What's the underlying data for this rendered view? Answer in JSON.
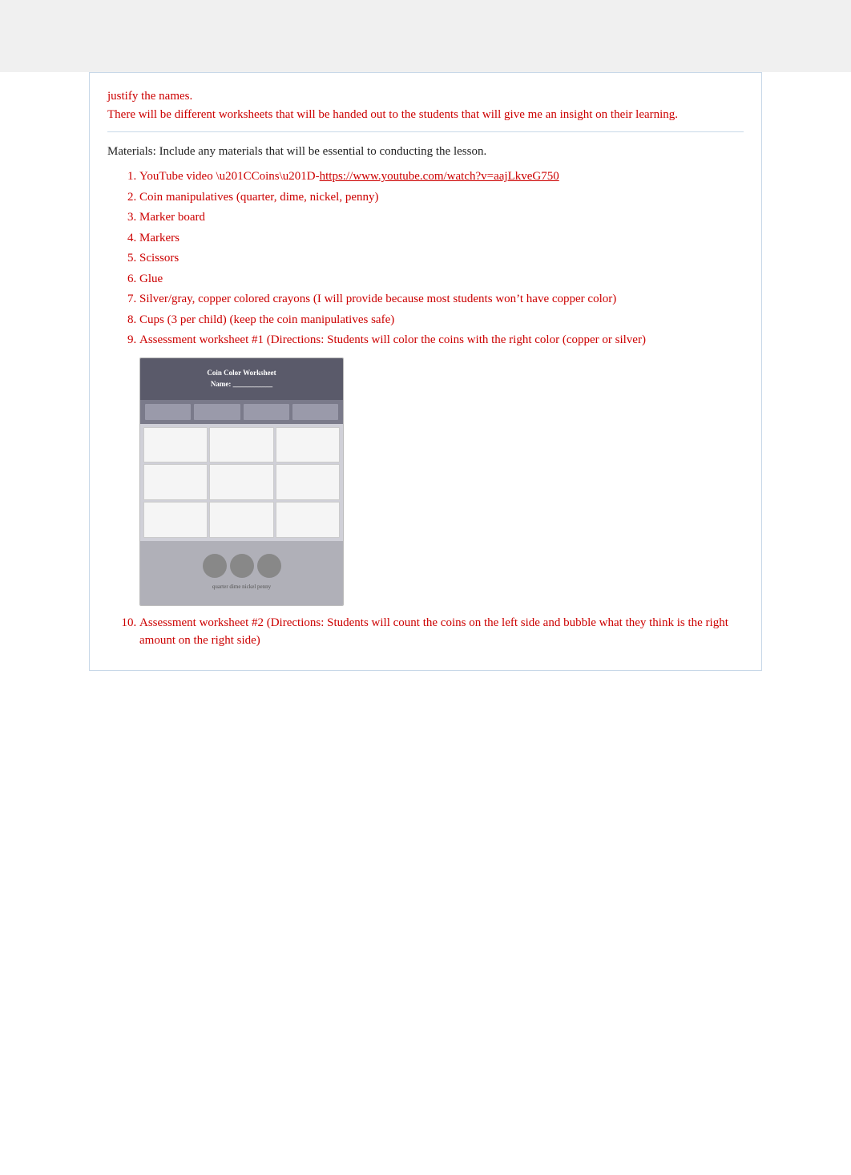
{
  "intro": {
    "line1": "justify the names.",
    "line2": "There will be different worksheets that will be handed out to the students that will give me an insight on their learning."
  },
  "materials_label": "Materials: Include any materials that will be essential to conducting the lesson.",
  "materials_list": [
    {
      "id": 1,
      "text": "YouTube video “Coins”-",
      "link": "https://www.youtube.com/watch?v=aajLkveG750",
      "link_text": "https://www.youtube.com/watch?v=aajLkveG750"
    },
    {
      "id": 2,
      "text": "Coin manipulatives (quarter, dime, nickel, penny)",
      "link": null
    },
    {
      "id": 3,
      "text": "Marker board",
      "link": null
    },
    {
      "id": 4,
      "text": "Markers",
      "link": null
    },
    {
      "id": 5,
      "text": "Scissors",
      "link": null
    },
    {
      "id": 6,
      "text": "Glue",
      "link": null
    },
    {
      "id": 7,
      "text": "Silver/gray, copper colored crayons (I will provide because most students won’t have copper color)",
      "link": null
    },
    {
      "id": 8,
      "text": "Cups (3 per child) (keep the coin manipulatives safe)",
      "link": null
    },
    {
      "id": 9,
      "text": "Assessment worksheet #1 (Directions: Students will color the coins with the right color (copper or silver)",
      "link": null
    },
    {
      "id": 10,
      "text": "Assessment worksheet #2 (Directions: Students will count the coins on the left side and bubble what they think is the right amount on the right side)",
      "link": null
    }
  ],
  "worksheet": {
    "header": "Coin Color Worksheet",
    "alt": "Assessment worksheet preview"
  }
}
